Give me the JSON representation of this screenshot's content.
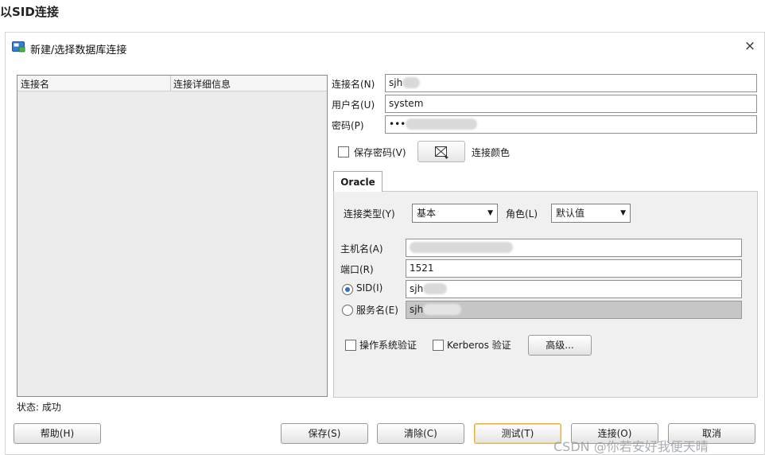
{
  "article_heading": "以SID连接",
  "dialog": {
    "title": "新建/选择数据库连接",
    "close_glyph": "×"
  },
  "connection_list": {
    "columns": [
      "连接名",
      "连接详细信息"
    ]
  },
  "fields": {
    "conn_name_label": "连接名(N)",
    "conn_name_value": "sjh",
    "username_label": "用户名(U)",
    "username_value": "system",
    "password_label": "密码(P)",
    "password_value": "•••"
  },
  "save_password": {
    "label": "保存密码(V)",
    "checked": false
  },
  "connection_color_label": "连接颜色",
  "tabs": [
    {
      "label": "Oracle",
      "active": true
    }
  ],
  "oracle": {
    "conn_type_label": "连接类型(Y)",
    "conn_type_value": "基本",
    "role_label": "角色(L)",
    "role_value": "默认值",
    "hostname_label": "主机名(A)",
    "hostname_value": "",
    "port_label": "端口(R)",
    "port_value": "1521",
    "sid_label": "SID(I)",
    "sid_value": "sjh",
    "sid_selected": true,
    "service_label": "服务名(E)",
    "service_value": "sjh",
    "os_auth_label": "操作系统验证",
    "kerberos_label": "Kerberos 验证",
    "advanced_button": "高级..."
  },
  "status": "状态: 成功",
  "buttons": {
    "help": "帮助(H)",
    "save": "保存(S)",
    "clear": "清除(C)",
    "test": "测试(T)",
    "connect": "连接(O)",
    "cancel": "取消"
  },
  "watermark": "CSDN @你若安好我便天晴",
  "colors": {
    "accent": "#2d6fd0",
    "focus_border": "#e0b04a",
    "disabled_field": "#c6c6c6",
    "list_background": "#ececec"
  }
}
